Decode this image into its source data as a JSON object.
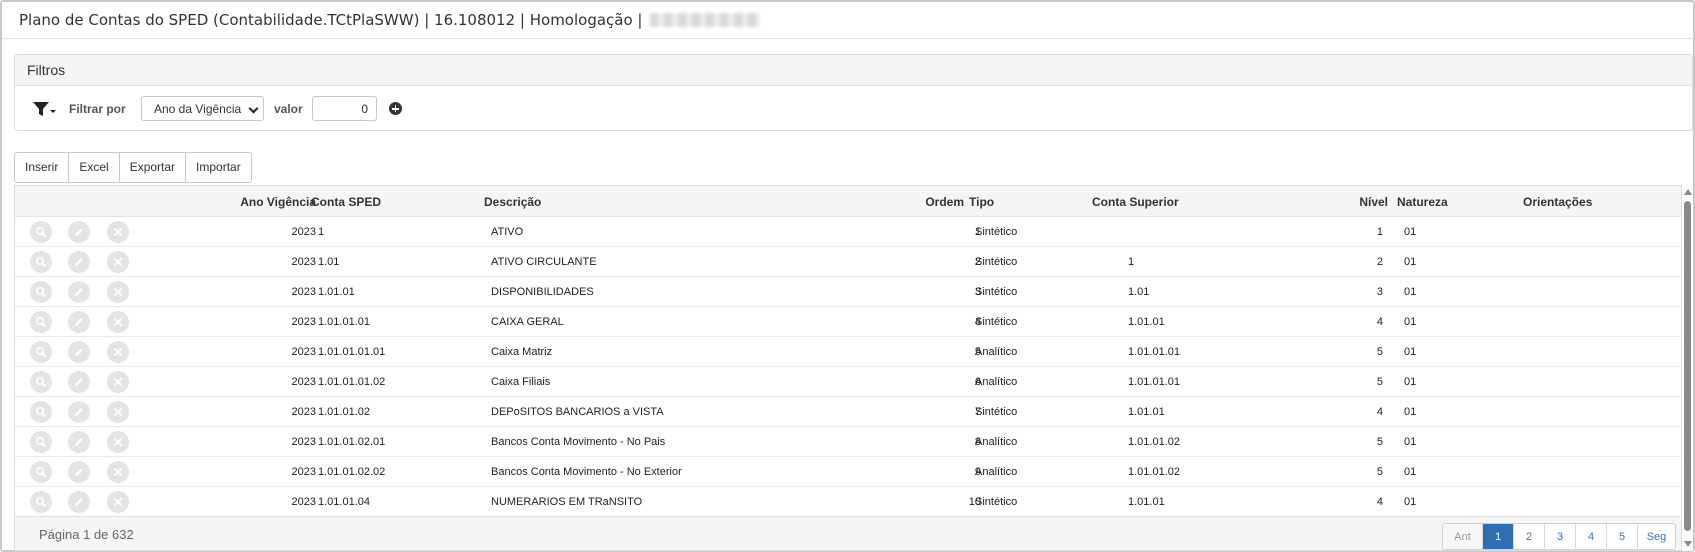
{
  "window": {
    "title": "Plano de Contas do SPED (Contabilidade.TCtPlaSWW) | 16.108012 | Homologação |"
  },
  "filters": {
    "header": "Filtros",
    "filter_by_label": "Filtrar por",
    "filter_field_selected": "Ano da Vigência",
    "value_label": "valor",
    "value": "0",
    "icons": {
      "funnel": "filter-funnel-icon",
      "add": "plus-circle-icon"
    }
  },
  "toolbar": {
    "insert": "Inserir",
    "excel": "Excel",
    "export": "Exportar",
    "import": "Importar"
  },
  "grid": {
    "columns": {
      "ano": "Ano Vigência",
      "conta": "Conta SPED",
      "descricao": "Descrição",
      "ordem": "Ordem",
      "tipo": "Tipo",
      "superior": "Conta Superior",
      "nivel": "Nível",
      "natureza": "Natureza",
      "orientacoes": "Orientações"
    },
    "rows": [
      {
        "ano": "2023",
        "conta": "1",
        "descricao": "ATIVO",
        "ordem": "1",
        "tipo": "Sintético",
        "superior": "",
        "nivel": "1",
        "natureza": "01",
        "orientacoes": ""
      },
      {
        "ano": "2023",
        "conta": "1.01",
        "descricao": "ATIVO CIRCULANTE",
        "ordem": "2",
        "tipo": "Sintético",
        "superior": "1",
        "nivel": "2",
        "natureza": "01",
        "orientacoes": ""
      },
      {
        "ano": "2023",
        "conta": "1.01.01",
        "descricao": "DISPONIBILIDADES",
        "ordem": "3",
        "tipo": "Sintético",
        "superior": "1.01",
        "nivel": "3",
        "natureza": "01",
        "orientacoes": ""
      },
      {
        "ano": "2023",
        "conta": "1.01.01.01",
        "descricao": "CAIXA GERAL",
        "ordem": "4",
        "tipo": "Sintético",
        "superior": "1.01.01",
        "nivel": "4",
        "natureza": "01",
        "orientacoes": ""
      },
      {
        "ano": "2023",
        "conta": "1.01.01.01.01",
        "descricao": "Caixa Matriz",
        "ordem": "5",
        "tipo": "Analítico",
        "superior": "1.01.01.01",
        "nivel": "5",
        "natureza": "01",
        "orientacoes": ""
      },
      {
        "ano": "2023",
        "conta": "1.01.01.01.02",
        "descricao": "Caixa Filiais",
        "ordem": "6",
        "tipo": "Analítico",
        "superior": "1.01.01.01",
        "nivel": "5",
        "natureza": "01",
        "orientacoes": ""
      },
      {
        "ano": "2023",
        "conta": "1.01.01.02",
        "descricao": "DEPoSITOS BANCARIOS a VISTA",
        "ordem": "7",
        "tipo": "Sintético",
        "superior": "1.01.01",
        "nivel": "4",
        "natureza": "01",
        "orientacoes": ""
      },
      {
        "ano": "2023",
        "conta": "1.01.01.02.01",
        "descricao": "Bancos Conta Movimento - No Pais",
        "ordem": "8",
        "tipo": "Analítico",
        "superior": "1.01.01.02",
        "nivel": "5",
        "natureza": "01",
        "orientacoes": ""
      },
      {
        "ano": "2023",
        "conta": "1.01.01.02.02",
        "descricao": "Bancos Conta Movimento - No Exterior",
        "ordem": "9",
        "tipo": "Analítico",
        "superior": "1.01.01.02",
        "nivel": "5",
        "natureza": "01",
        "orientacoes": ""
      },
      {
        "ano": "2023",
        "conta": "1.01.01.04",
        "descricao": "NUMERARIOS EM TRaNSITO",
        "ordem": "10",
        "tipo": "Sintético",
        "superior": "1.01.01",
        "nivel": "4",
        "natureza": "01",
        "orientacoes": ""
      }
    ],
    "row_action_icons": [
      "search-icon",
      "edit-pencil-icon",
      "delete-x-icon"
    ]
  },
  "footer": {
    "page_info": "Página 1 de 632",
    "pager": {
      "prev": "Ant",
      "pages": [
        "1",
        "2",
        "3",
        "4",
        "5"
      ],
      "active_page": "1",
      "next": "Seg"
    }
  },
  "colors": {
    "pager_active": "#2f6faf",
    "link": "#3a74b8",
    "header_bg": "#f5f5f5"
  }
}
